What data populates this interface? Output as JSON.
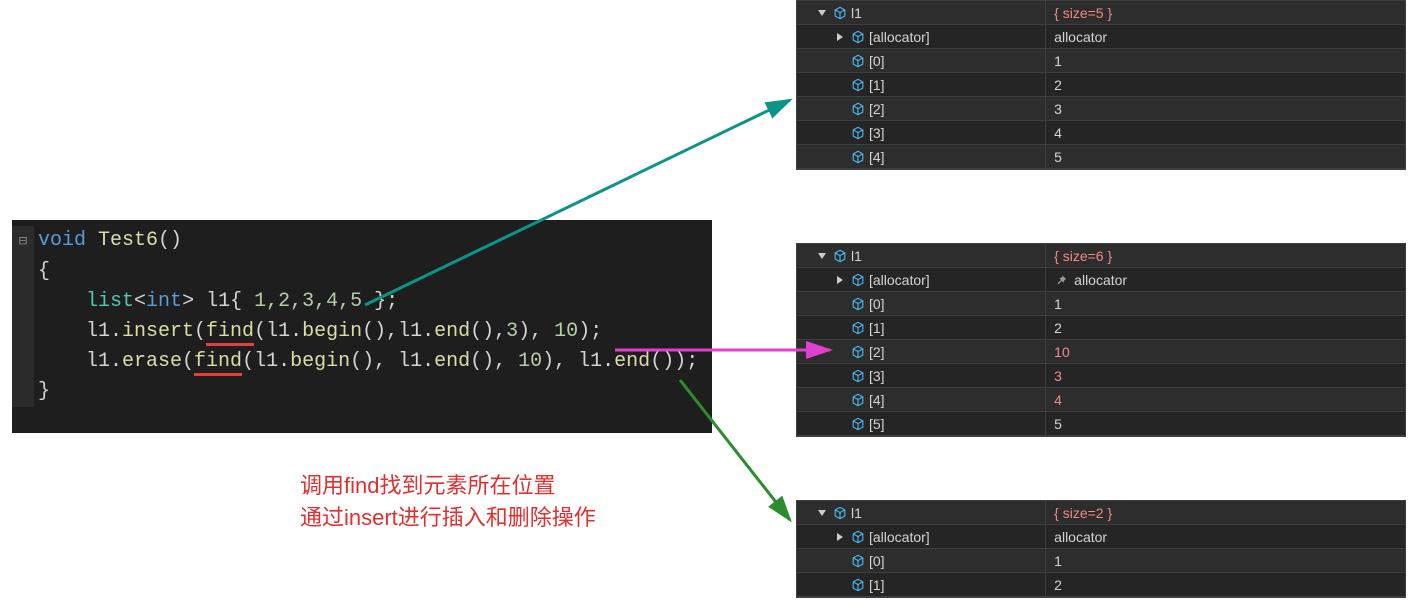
{
  "code": {
    "line1_kw": "void",
    "line1_fn": " Test6",
    "line1_rest": "()",
    "line2": "{",
    "line3_lead": "    ",
    "line3_cls": "list",
    "line3_lt": "<",
    "line3_type": "int",
    "line3_gt": "> l1{ ",
    "line3_nums": "1,2,3,4,5",
    "line3_end": " };",
    "line4_lead": "    l1.",
    "line4_insert": "insert",
    "line4_open": "(",
    "line4_find": "find",
    "line4_rest1": "(l1.",
    "line4_begin": "begin",
    "line4_rest2": "(),l1.",
    "line4_end1": "end",
    "line4_rest3": "(),",
    "line4_num1": "3",
    "line4_rest4": "), ",
    "line4_num2": "10",
    "line4_rest5": ");",
    "line5_lead": "    l1.",
    "line5_erase": "erase",
    "line5_open": "(",
    "line5_find": "find",
    "line5_rest1": "(l1.",
    "line5_begin": "begin",
    "line5_rest2": "(), l1.",
    "line5_end1": "end",
    "line5_rest3": "(), ",
    "line5_num1": "10",
    "line5_rest4": "), l1.",
    "line5_end2": "end",
    "line5_rest5": "());",
    "line6": "}"
  },
  "annotation": {
    "line1": "调用find找到元素所在位置",
    "line2": "通过insert进行插入和删除操作"
  },
  "watch1": {
    "var": "l1",
    "size": "{ size=5 }",
    "allocator_label": "[allocator]",
    "allocator_value": "allocator",
    "items": [
      {
        "key": "[0]",
        "val": "1"
      },
      {
        "key": "[1]",
        "val": "2"
      },
      {
        "key": "[2]",
        "val": "3"
      },
      {
        "key": "[3]",
        "val": "4"
      },
      {
        "key": "[4]",
        "val": "5"
      }
    ]
  },
  "watch2": {
    "var": "l1",
    "size": "{ size=6 }",
    "allocator_label": "[allocator]",
    "allocator_value": "allocator",
    "items": [
      {
        "key": "[0]",
        "val": "1",
        "changed": false
      },
      {
        "key": "[1]",
        "val": "2",
        "changed": false
      },
      {
        "key": "[2]",
        "val": "10",
        "changed": true
      },
      {
        "key": "[3]",
        "val": "3",
        "changed": true
      },
      {
        "key": "[4]",
        "val": "4",
        "changed": true
      },
      {
        "key": "[5]",
        "val": "5",
        "changed": false
      }
    ]
  },
  "watch3": {
    "var": "l1",
    "size": "{ size=2 }",
    "allocator_label": "[allocator]",
    "allocator_value": "allocator",
    "items": [
      {
        "key": "[0]",
        "val": "1"
      },
      {
        "key": "[1]",
        "val": "2"
      }
    ]
  },
  "colors": {
    "arrow_teal": "#0d9488",
    "arrow_magenta": "#e040d0",
    "arrow_green": "#2e8b2e",
    "annotation_red": "#e03030"
  }
}
